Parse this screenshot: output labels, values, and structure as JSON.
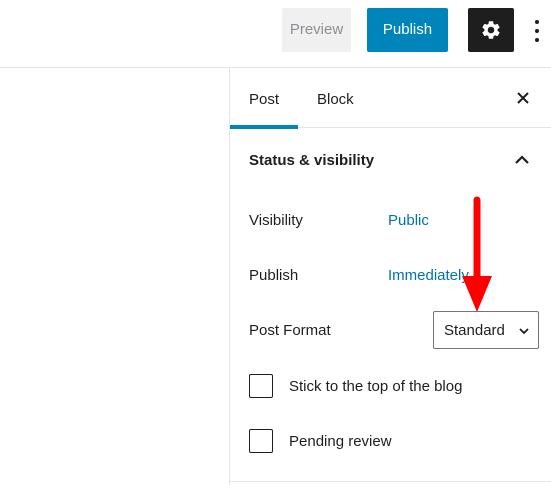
{
  "toolbar": {
    "preview_label": "Preview",
    "publish_label": "Publish",
    "settings_icon": "gear-icon",
    "more_icon": "vertical-ellipsis-icon"
  },
  "sidebar": {
    "tabs": [
      {
        "label": "Post",
        "active": true
      },
      {
        "label": "Block",
        "active": false
      }
    ],
    "close_icon": "close-icon"
  },
  "status_panel": {
    "title": "Status & visibility",
    "expanded": true,
    "rows": {
      "visibility": {
        "label": "Visibility",
        "value": "Public"
      },
      "publish": {
        "label": "Publish",
        "value": "Immediately"
      },
      "post_format": {
        "label": "Post Format",
        "value": "Standard"
      }
    },
    "checkboxes": [
      {
        "label": "Stick to the top of the blog",
        "checked": false
      },
      {
        "label": "Pending review",
        "checked": false
      }
    ]
  },
  "colors": {
    "accent": "#0085ba",
    "link": "#0073aa",
    "annotation": "#ff0000"
  }
}
